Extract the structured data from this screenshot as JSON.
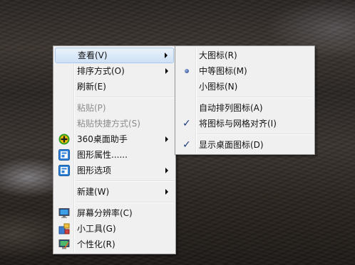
{
  "main_menu": {
    "items": [
      {
        "label": "查看(V)"
      },
      {
        "label": "排序方式(O)"
      },
      {
        "label": "刷新(E)"
      },
      {
        "label": "粘贴(P)"
      },
      {
        "label": "粘贴快捷方式(S)"
      },
      {
        "label": "360桌面助手"
      },
      {
        "label": "图形属性......"
      },
      {
        "label": "图形选项"
      },
      {
        "label": "新建(W)"
      },
      {
        "label": "屏幕分辨率(C)"
      },
      {
        "label": "小工具(G)"
      },
      {
        "label": "个性化(R)"
      }
    ]
  },
  "sub_menu": {
    "items": [
      {
        "label": "大图标(R)"
      },
      {
        "label": "中等图标(M)",
        "selected": true
      },
      {
        "label": "小图标(N)"
      },
      {
        "label": "自动排列图标(A)"
      },
      {
        "label": "将图标与网格对齐(I)",
        "checked": true
      },
      {
        "label": "显示桌面图标(D)",
        "checked": true
      }
    ]
  },
  "icons": {
    "assistant_360": "360-plus-icon",
    "graphics_props": "graphics-properties-icon",
    "graphics_options": "graphics-options-icon",
    "resolution": "monitor-icon",
    "gadgets": "gadgets-icon",
    "personalize": "personalize-icon",
    "check_glyph": "✓"
  },
  "colors": {
    "menu_bg": "#f0f0f0",
    "hover_border": "#a8c8ec",
    "disabled_text": "#8c8c8c"
  }
}
